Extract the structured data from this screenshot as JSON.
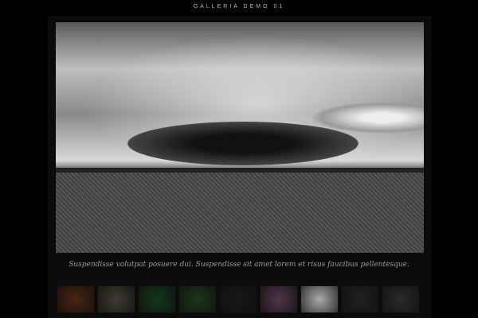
{
  "header": {
    "title": "GALLERIA DEMO 01"
  },
  "main_image": {
    "caption": "Suspendisse volutpat posuere dui. Suspendisse sit amet lorem et risus faucibus pellentesque."
  },
  "thumbnails": [
    {
      "name": "leaf",
      "color": "#7a3a1a",
      "active": false
    },
    {
      "name": "stones",
      "color": "#6a6358",
      "active": false
    },
    {
      "name": "grass",
      "color": "#1f5a2a",
      "active": false
    },
    {
      "name": "ladybug",
      "color": "#2b5a2b",
      "active": false
    },
    {
      "name": "dark-sky",
      "color": "#222",
      "active": false
    },
    {
      "name": "lotus",
      "color": "#8a5a7a",
      "active": false
    },
    {
      "name": "desert-sky",
      "color": "#aaa",
      "active": true
    },
    {
      "name": "dark-shore",
      "color": "#333",
      "active": false
    },
    {
      "name": "rocks",
      "color": "#444",
      "active": false
    }
  ]
}
